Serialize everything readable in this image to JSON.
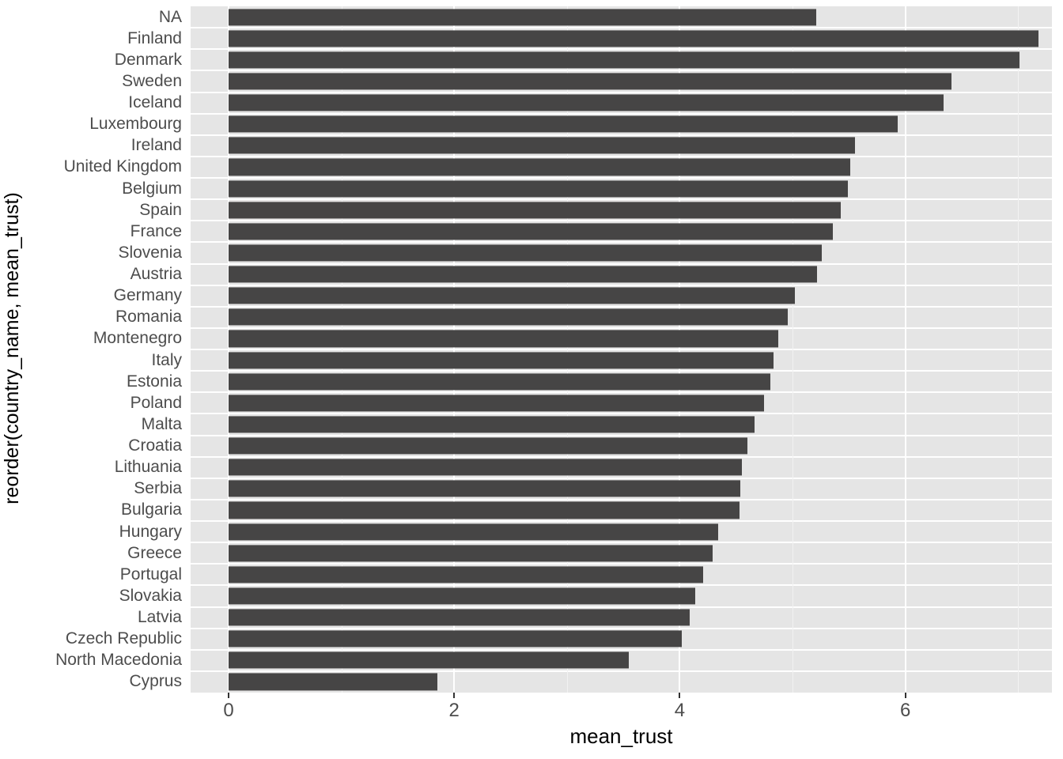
{
  "chart_data": {
    "type": "bar",
    "orientation": "horizontal",
    "title": "",
    "xlabel": "mean_trust",
    "ylabel": "reorder(country_name, mean_trust)",
    "xlim": [
      0,
      7.25
    ],
    "x_ticks": [
      0,
      2,
      4,
      6
    ],
    "x_tick_labels": [
      "0",
      "2",
      "4",
      "6"
    ],
    "grid": true,
    "grid_major_x": [
      0,
      2,
      4,
      6
    ],
    "grid_minor_x": [
      1,
      3,
      5,
      7
    ],
    "legend": "none",
    "bar_color": "#464545",
    "panel_color": "#e5e5e5",
    "gridline_color": "#ffffff",
    "categories": [
      "NA",
      "Finland",
      "Denmark",
      "Sweden",
      "Iceland",
      "Luxembourg",
      "Ireland",
      "United Kingdom",
      "Belgium",
      "Spain",
      "France",
      "Slovenia",
      "Austria",
      "Germany",
      "Romania",
      "Montenegro",
      "Italy",
      "Estonia",
      "Poland",
      "Malta",
      "Croatia",
      "Lithuania",
      "Serbia",
      "Bulgaria",
      "Hungary",
      "Greece",
      "Portugal",
      "Slovakia",
      "Latvia",
      "Czech Republic",
      "North Macedonia",
      "Cyprus"
    ],
    "values": [
      5.21,
      7.18,
      7.01,
      6.41,
      6.34,
      5.93,
      5.55,
      5.51,
      5.49,
      5.43,
      5.36,
      5.26,
      5.22,
      5.02,
      4.96,
      4.87,
      4.83,
      4.8,
      4.75,
      4.66,
      4.6,
      4.55,
      4.54,
      4.53,
      4.34,
      4.29,
      4.21,
      4.14,
      4.09,
      4.02,
      3.55,
      1.85
    ]
  }
}
